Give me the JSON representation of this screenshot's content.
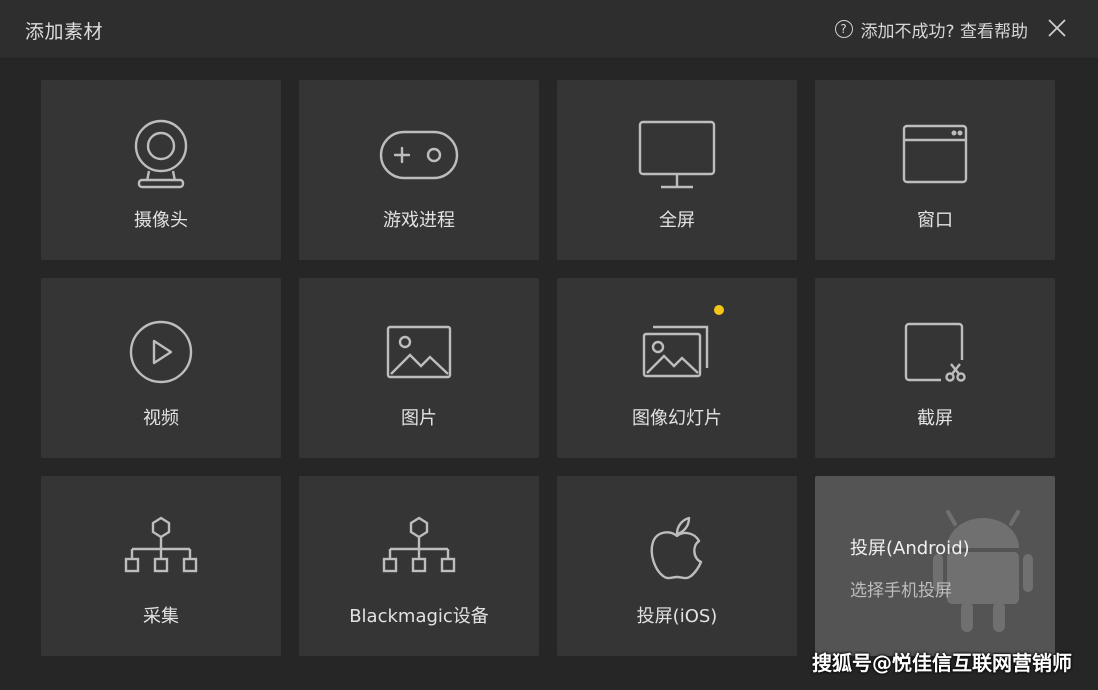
{
  "window": {
    "title": "添加素材",
    "help_text": "添加不成功? 查看帮助",
    "help_icon": "question-circle-icon",
    "close_icon": "close-icon"
  },
  "tiles": [
    {
      "label": "摄像头",
      "icon": "webcam-icon"
    },
    {
      "label": "游戏进程",
      "icon": "gamepad-icon"
    },
    {
      "label": "全屏",
      "icon": "monitor-icon"
    },
    {
      "label": "窗口",
      "icon": "window-icon"
    },
    {
      "label": "视频",
      "icon": "play-circle-icon"
    },
    {
      "label": "图片",
      "icon": "image-icon"
    },
    {
      "label": "图像幻灯片",
      "icon": "slideshow-icon",
      "badge_color": "#f5c518"
    },
    {
      "label": "截屏",
      "icon": "screenshot-scissors-icon"
    },
    {
      "label": "采集",
      "icon": "capture-network-icon"
    },
    {
      "label": "Blackmagic设备",
      "icon": "blackmagic-network-icon"
    },
    {
      "label": "投屏(iOS)",
      "icon": "apple-icon"
    },
    {
      "label": "投屏(Android)",
      "sublabel": "选择手机投屏",
      "icon": "android-icon"
    }
  ],
  "watermark": "搜狐号@悦佳信互联网营销师",
  "colors": {
    "background": "#262626",
    "tile": "#353535",
    "tile_hover": "#545454",
    "accent_dot": "#f5c518"
  }
}
